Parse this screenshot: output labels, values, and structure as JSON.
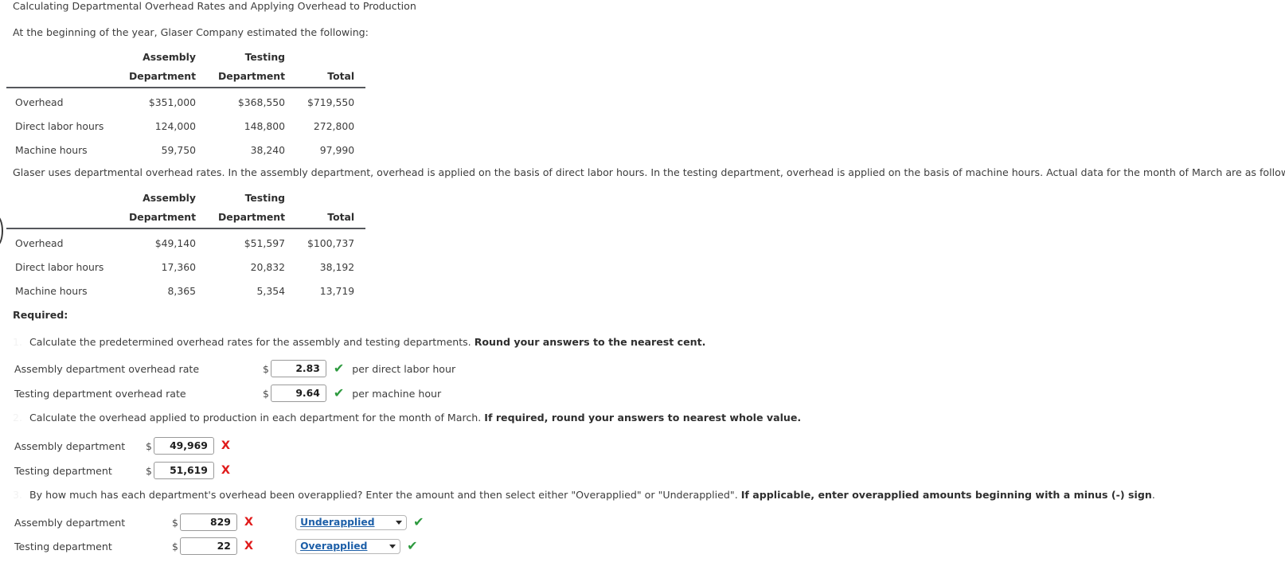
{
  "title": "Calculating Departmental Overhead Rates and Applying Overhead to Production",
  "intro": "At the beginning of the year, Glaser Company estimated the following:",
  "paragraph": "Glaser uses departmental overhead rates. In the assembly department, overhead is applied on the basis of direct labor hours. In the testing department, overhead is applied on the basis of machine hours. Actual data for the month of March are as follows:",
  "required_label": "Required:",
  "tables": {
    "estimated": {
      "header_row1": [
        "",
        "Assembly",
        "Testing",
        ""
      ],
      "header_row2": [
        "",
        "Department",
        "Department",
        "Total"
      ],
      "rows": [
        {
          "label": "Overhead",
          "assembly": "$351,000",
          "testing": "$368,550",
          "total": "$719,550"
        },
        {
          "label": "Direct labor hours",
          "assembly": "124,000",
          "testing": "148,800",
          "total": "272,800"
        },
        {
          "label": "Machine hours",
          "assembly": "59,750",
          "testing": "38,240",
          "total": "97,990"
        }
      ]
    },
    "actual": {
      "header_row1": [
        "",
        "Assembly",
        "Testing",
        ""
      ],
      "header_row2": [
        "",
        "Department",
        "Department",
        "Total"
      ],
      "rows": [
        {
          "label": "Overhead",
          "assembly": "$49,140",
          "testing": "$51,597",
          "total": "$100,737"
        },
        {
          "label": "Direct labor hours",
          "assembly": "17,360",
          "testing": "20,832",
          "total": "38,192"
        },
        {
          "label": "Machine hours",
          "assembly": "8,365",
          "testing": "5,354",
          "total": "13,719"
        }
      ]
    }
  },
  "questions": {
    "q1": {
      "marker": "1.",
      "text": "Calculate the predetermined overhead rates for the assembly and testing departments. ",
      "bold": "Round your answers to the nearest cent.",
      "rows": [
        {
          "label": "Assembly department overhead rate",
          "currency": "$",
          "value": "2.83",
          "mark": "✔",
          "mark_state": "correct",
          "unit": "per direct labor hour"
        },
        {
          "label": "Testing department overhead rate",
          "currency": "$",
          "value": "9.64",
          "mark": "✔",
          "mark_state": "correct",
          "unit": "per machine hour"
        }
      ]
    },
    "q2": {
      "marker": "2.",
      "text": "Calculate the overhead applied to production in each department for the month of March. ",
      "bold": "If required, round your answers to nearest whole value.",
      "rows": [
        {
          "label": "Assembly department",
          "currency": "$",
          "value": "49,969",
          "mark": "X",
          "mark_state": "incorrect"
        },
        {
          "label": "Testing department",
          "currency": "$",
          "value": "51,619",
          "mark": "X",
          "mark_state": "incorrect"
        }
      ]
    },
    "q3": {
      "marker": "3.",
      "text": "By how much has each department's overhead been overapplied? Enter the amount and then select either \"Overapplied\" or \"Underapplied\". ",
      "bold": "If applicable, enter overapplied amounts beginning with a minus (-) sign",
      "text_after": ".",
      "rows": [
        {
          "label": "Assembly department",
          "currency": "$",
          "value": "829",
          "mark": "X",
          "mark_state": "incorrect",
          "select_value": "Underapplied",
          "select_mark": "✔",
          "select_mark_state": "correct"
        },
        {
          "label": "Testing department",
          "currency": "$",
          "value": "22",
          "mark": "X",
          "mark_state": "incorrect",
          "select_value": "Overapplied",
          "select_mark": "✔",
          "select_mark_state": "correct"
        }
      ]
    }
  },
  "colors": {
    "correct": "#2d9a3e",
    "incorrect": "#e01b1b",
    "select_text": "#1d5fa8",
    "text": "#3d3d3d"
  }
}
